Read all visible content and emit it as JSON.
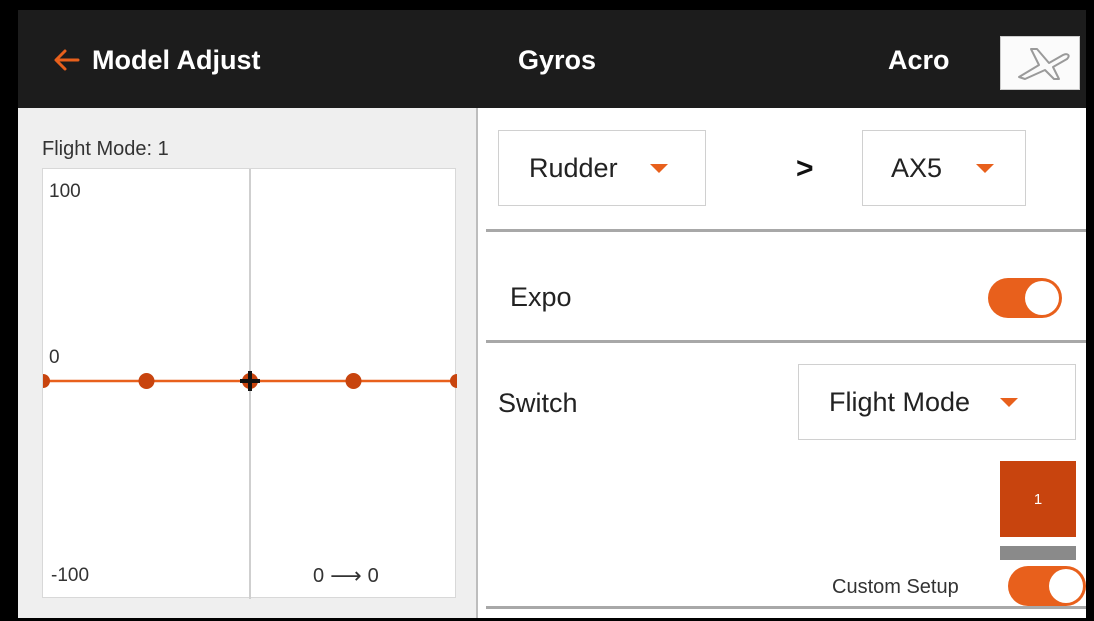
{
  "header": {
    "back_label": "Model Adjust",
    "title": "Gyros",
    "model_name": "Acro",
    "model_icon": "airplane-icon"
  },
  "left_panel": {
    "flight_mode_label": "Flight Mode: 1",
    "graph": {
      "y_top": "100",
      "y_mid": "0",
      "y_bottom": "-100",
      "readout_from": "0",
      "readout_to": "0",
      "curve_points": [
        [
          -100,
          0
        ],
        [
          -50,
          0
        ],
        [
          0,
          0
        ],
        [
          50,
          0
        ],
        [
          100,
          0
        ]
      ],
      "cursor_x": 0,
      "cursor_y": 0
    }
  },
  "channel": {
    "source": "Rudder",
    "separator": ">",
    "target": "AX5"
  },
  "expo": {
    "label": "Expo",
    "enabled": true
  },
  "switch": {
    "label": "Switch",
    "value": "Flight Mode"
  },
  "flight_mode_indicator": {
    "value": "1"
  },
  "custom_setup": {
    "label": "Custom Setup",
    "enabled": true
  },
  "colors": {
    "accent": "#e8601c",
    "header_bg": "#1c1c1c",
    "indicator": "#c8440e"
  }
}
